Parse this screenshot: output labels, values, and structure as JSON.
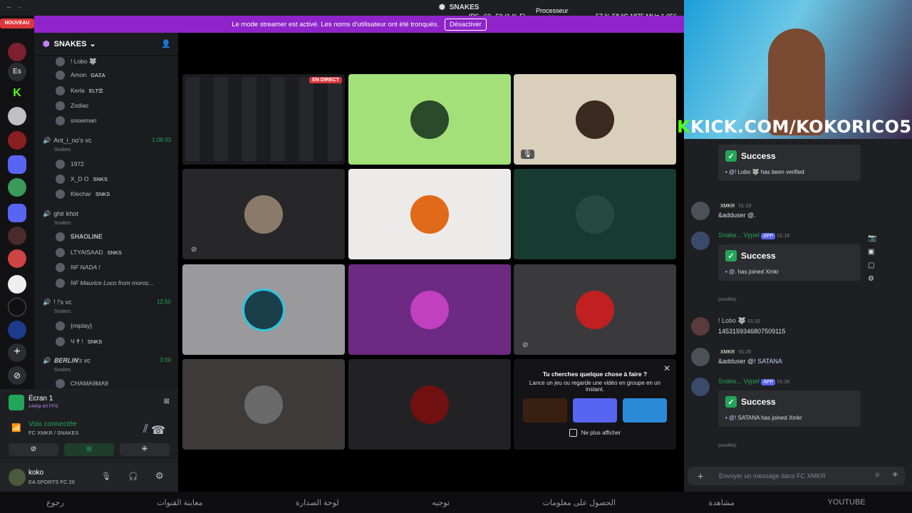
{
  "topbar": {
    "server": "SNAKES",
    "fps_label": "IPS",
    "fps1": "60",
    "fps2": "59 (1 % F)",
    "cpu_label": "Processeur graphique",
    "cpu_stats": "57 % 58 °C 1875 MHz 1.056",
    "badge": "NOUVEAU"
  },
  "banner": {
    "text": "Le mode streamer est activé. Les noms d'utilisateur ont été tronqués.",
    "button": "Désactiver"
  },
  "sidebar": {
    "server_name": "SNAKES",
    "members_top": [
      {
        "name": "! Lobo 🐺",
        "tag": ""
      },
      {
        "name": "Amon",
        "tag": "GAZA"
      },
      {
        "name": "Kerla",
        "tag": "ELT☰"
      },
      {
        "name": "Zodiac",
        "tag": ""
      },
      {
        "name": "snowman",
        "tag": ""
      }
    ],
    "vc1": {
      "name": "Ant_i_no's vc",
      "sub": "Snakes",
      "time": "1:08:33"
    },
    "vc1_members": [
      {
        "name": "1972",
        "tag": ""
      },
      {
        "name": "X_D O",
        "tag": "SNKS"
      },
      {
        "name": "Klechar",
        "tag": "SNKS"
      }
    ],
    "vc2": {
      "name": "ghir khot",
      "sub": "Snakes"
    },
    "vc2_members": [
      {
        "name": "𝐒𝐇𝐀𝐎𝐋𝐈𝐍𝐄",
        "tag": ""
      },
      {
        "name": "LTYAISAAD",
        "tag": "SNKS"
      },
      {
        "name": "NF NADA !",
        "tag": ""
      },
      {
        "name": "NF Maurice Loco from moroc...",
        "tag": ""
      }
    ],
    "vc3": {
      "name": "! !'s vc",
      "sub": "Snakes",
      "time": "12:50"
    },
    "vc3_members": [
      {
        "name": "{miplay}",
        "tag": ""
      },
      {
        "name": "Ч 🕇 !",
        "tag": "SNKS"
      }
    ],
    "vc4": {
      "name": "𝐁𝐄𝐑𝐋𝐈𝐍's vc",
      "sub": "Snakes",
      "time": "3:00"
    },
    "vc4_members": [
      {
        "name": "CHAMA9MA9",
        "tag": ""
      }
    ]
  },
  "panel": {
    "screen_title": "Écran 1",
    "screen_sub": "1440p 60 FPS",
    "voice_status": "Voix connectée",
    "voice_sub": "FC XMKR / SNAKES",
    "user": "koko",
    "user_status": "EA SPORTS FC 26"
  },
  "grid": {
    "live_badge": "EN DIRECT",
    "tiles": [
      {
        "label": "screen-share",
        "bg": "#1a1b1e",
        "pic": ""
      },
      {
        "label": "user",
        "bg": "#a3e07a",
        "pic": "#2a4a2a"
      },
      {
        "label": "user",
        "bg": "#d9cfba",
        "pic": "#3a2a1f"
      },
      {
        "label": "user",
        "bg": "#27272a",
        "pic": "#8a7a6a"
      },
      {
        "label": "user",
        "bg": "#ecebe9",
        "pic": "#e06a1a"
      },
      {
        "label": "user",
        "bg": "#173a31",
        "pic": "#264a40"
      },
      {
        "label": "user",
        "bg": "#9a9a9d",
        "pic": "#1b3f4a"
      },
      {
        "label": "user",
        "bg": "#6c2a83",
        "pic": "#c040c0"
      },
      {
        "label": "user",
        "bg": "#3a3a3c",
        "pic": "#c02020"
      },
      {
        "label": "user",
        "bg": "#3d3a38",
        "pic": "#6a6a6a"
      },
      {
        "label": "user",
        "bg": "#222224",
        "pic": "#701010"
      }
    ],
    "promo": {
      "title": "Tu cherches quelque chose à faire ?",
      "body": "Lance un jeu ou regarde une vidéo en groupe en un instant.",
      "checkbox": "Ne plus afficher"
    }
  },
  "cam": {
    "kick_prefix": "K",
    "kick_text": "KICK.COM/KOKORICO569"
  },
  "chat": {
    "success1": {
      "title": "Success",
      "body_pre": "@!",
      "user": "Lobo 🐺",
      "body_post": "has been verified"
    },
    "msg1": {
      "author": "",
      "tag": "XMKR",
      "time": "01:18",
      "text": "&adduser @."
    },
    "msg2": {
      "author": "Snake... Vypel",
      "app": "APP",
      "time": "01:18"
    },
    "success2": {
      "title": "Success",
      "body_pre": "@.",
      "body_post": "has joined",
      "server": "Xmkr"
    },
    "modified1": "(modifié)",
    "msg3": {
      "author": "! Lobo 🐺",
      "time": "01:20",
      "text": "1453159346807509115"
    },
    "msg4": {
      "author": "",
      "tag": "XMKR",
      "time": "01:26",
      "text": "&adduser @!",
      "target": "SATANA"
    },
    "msg5": {
      "author": "Snake... Vypel",
      "app": "APP",
      "time": "01:26"
    },
    "success3": {
      "title": "Success",
      "body_pre": "@!",
      "user": "SATANA",
      "body_post": "has joined",
      "server": "Xmkr"
    },
    "modified2": "(modifié)",
    "input_placeholder": "Envoyer un message dans FC XMKR"
  },
  "taskbar": {
    "items": [
      "رجوع",
      "معاينة القنوات",
      "لوحة الصدارة",
      "توجيه",
      "الحصول على معلومات",
      "مشاهدة",
      "YOUTUBE"
    ]
  },
  "colors": {
    "accent": "#8e24c9",
    "green": "#23a559",
    "blurple": "#5865f2",
    "kick": "#53fc18"
  }
}
